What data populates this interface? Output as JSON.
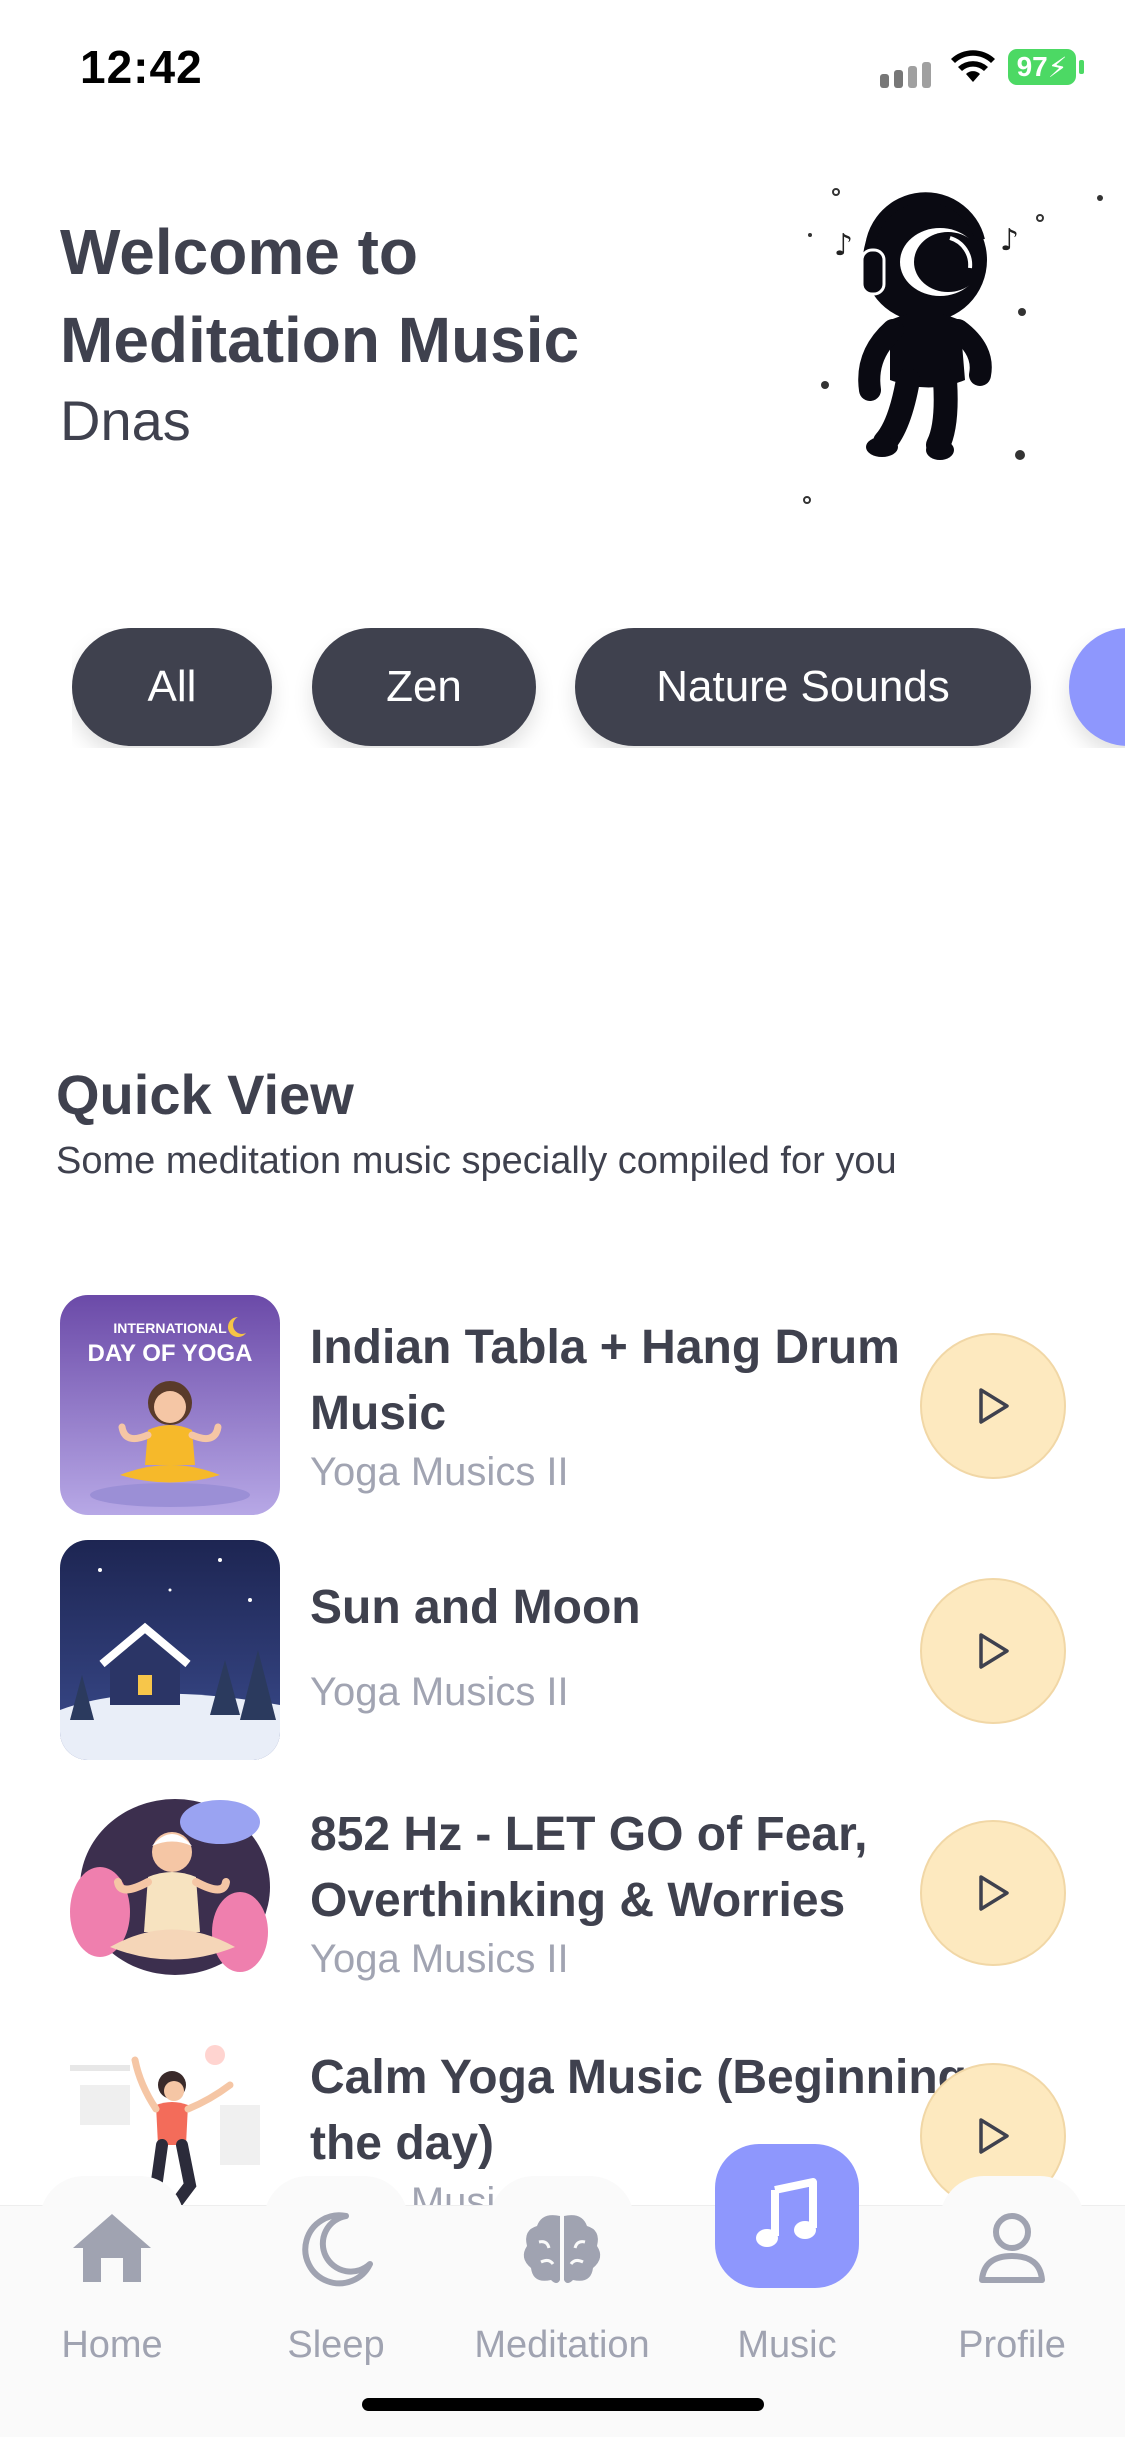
{
  "status_bar": {
    "time": "12:42",
    "battery": "97"
  },
  "header": {
    "welcome_line1": "Welcome to",
    "welcome_line2": "Meditation Music",
    "user_name": "Dnas"
  },
  "categories": [
    "All",
    "Zen",
    "Nature Sounds"
  ],
  "quick_view": {
    "title": "Quick View",
    "subtitle": "Some meditation music specially compiled for you",
    "tracks": [
      {
        "title": "Indian Tabla + Hang Drum Music",
        "artist": "Yoga Musics II",
        "thumb_text_1": "INTERNATIONAL",
        "thumb_text_2": "DAY OF YOGA"
      },
      {
        "title": "Sun and Moon",
        "artist": "Yoga Musics II"
      },
      {
        "title": "852 Hz - LET GO of Fear, Overthinking & Worries",
        "artist": "Yoga Musics II"
      },
      {
        "title": "Calm Yoga Music (Beginning the day)",
        "artist": "Yoga Musics II"
      }
    ]
  },
  "tabs": [
    {
      "label": "Home",
      "icon": "home-icon"
    },
    {
      "label": "Sleep",
      "icon": "moon-icon"
    },
    {
      "label": "Meditation",
      "icon": "brain-icon"
    },
    {
      "label": "Music",
      "icon": "music-note-icon",
      "active": true
    },
    {
      "label": "Profile",
      "icon": "user-icon"
    }
  ],
  "colors": {
    "primary_dark": "#3f414e",
    "accent": "#8e97fd",
    "play_button": "#fde9bf",
    "muted_text": "#a1a4b2",
    "battery": "#4cd964"
  }
}
